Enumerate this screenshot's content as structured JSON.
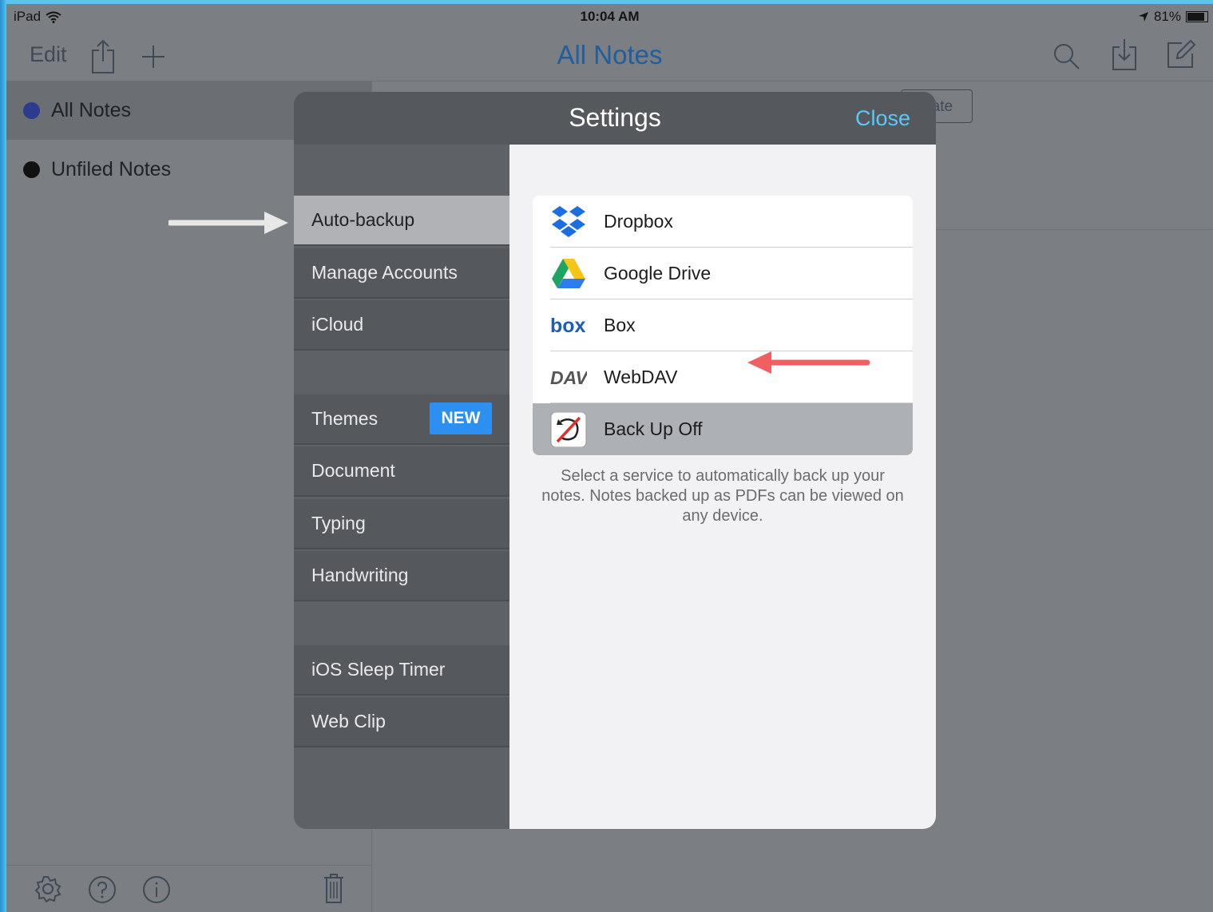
{
  "status_bar": {
    "device": "iPad",
    "time": "10:04 AM",
    "battery": "81%",
    "battery_level": 0.81
  },
  "nav": {
    "edit": "Edit",
    "title": "All Notes"
  },
  "sidebar": {
    "items": [
      {
        "label": "All Notes",
        "dot_color": "#2c3a8f"
      },
      {
        "label": "Unfiled Notes",
        "dot_color": "#111111"
      }
    ]
  },
  "background": {
    "segment_partial": "Date"
  },
  "settings": {
    "title": "Settings",
    "close": "Close",
    "menu": {
      "auto_backup": "Auto-backup",
      "manage_accounts": "Manage Accounts",
      "icloud": "iCloud",
      "themes": "Themes",
      "themes_badge": "NEW",
      "document": "Document",
      "typing": "Typing",
      "handwriting": "Handwriting",
      "sleep_timer": "iOS Sleep Timer",
      "web_clip": "Web Clip"
    },
    "services": [
      {
        "label": "Dropbox",
        "icon": "dropbox-icon"
      },
      {
        "label": "Google Drive",
        "icon": "google-drive-icon"
      },
      {
        "label": "Box",
        "icon": "box-icon"
      },
      {
        "label": "WebDAV",
        "icon": "webdav-icon"
      },
      {
        "label": "Back Up Off",
        "icon": "backup-off-icon",
        "selected": true
      }
    ],
    "description": "Select a service to automatically back up your notes. Notes backed up as PDFs can be viewed on any device."
  },
  "colors": {
    "accent": "#5ac8fa",
    "nav_title": "#1f5f9f",
    "badge": "#2d8ff0",
    "annotation_arrow": "#f06060"
  }
}
